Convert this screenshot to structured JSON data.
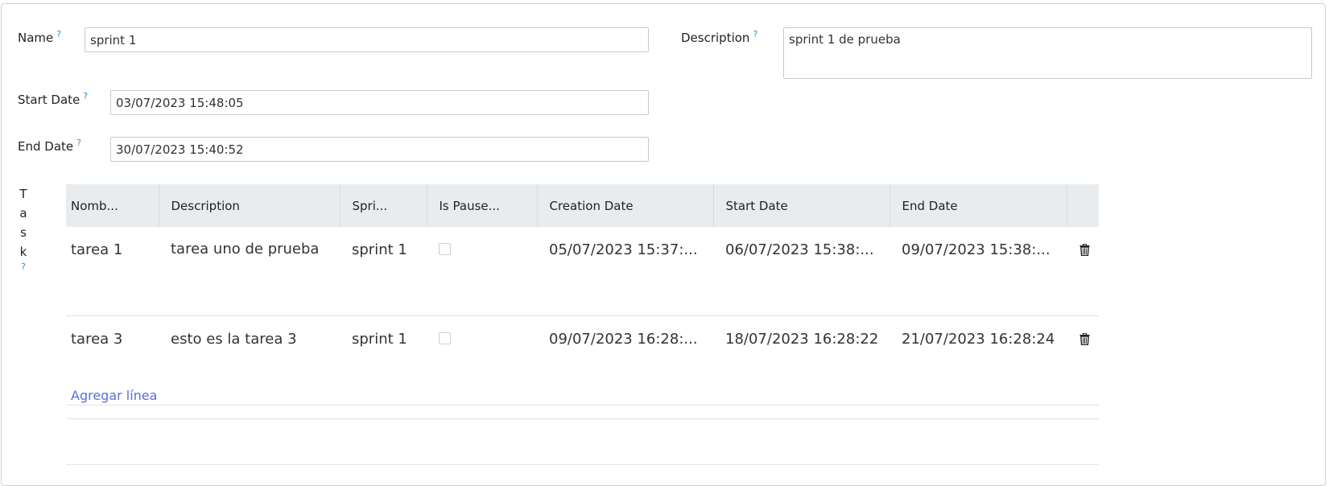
{
  "form": {
    "name": {
      "label": "Name",
      "help": "?",
      "value": "sprint 1"
    },
    "description": {
      "label": "Description",
      "help": "?",
      "value": "sprint 1 de prueba"
    },
    "start_date": {
      "label": "Start Date",
      "help": "?",
      "value": "03/07/2023 15:48:05"
    },
    "end_date": {
      "label": "End Date",
      "help": "?",
      "value": "30/07/2023 15:40:52"
    }
  },
  "task": {
    "label_letters": [
      "T",
      "a",
      "s",
      "k"
    ],
    "help": "?",
    "columns": [
      "Nomb...",
      "Description",
      "Spri...",
      "Is Pause...",
      "Creation Date",
      "Start Date",
      "End Date",
      ""
    ],
    "rows": [
      {
        "nombre": "tarea 1",
        "description": "tarea uno de prueba",
        "sprint": "sprint 1",
        "is_paused": false,
        "creation_date": "05/07/2023 15:37:...",
        "start_date": "06/07/2023 15:38:...",
        "end_date": "09/07/2023 15:38:..."
      },
      {
        "nombre": "tarea 3",
        "description": "esto es la tarea 3",
        "sprint": "sprint 1",
        "is_paused": false,
        "creation_date": "09/07/2023 16:28:...",
        "start_date": "18/07/2023 16:28:22",
        "end_date": "21/07/2023 16:28:24"
      }
    ],
    "add_line": "Agregar línea",
    "delete_icon": "trash-icon"
  },
  "colors": {
    "help": "#2b8fc6",
    "link": "#5a6fd6",
    "header_bg": "#e9ecef"
  }
}
